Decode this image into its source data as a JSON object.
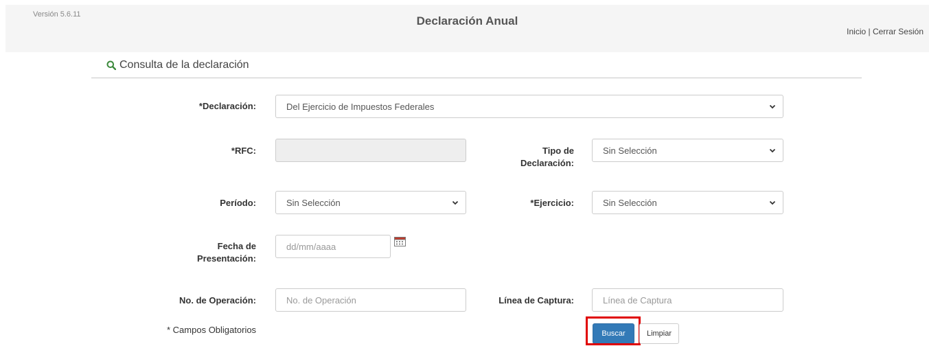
{
  "header": {
    "version": "Versión 5.6.11",
    "title": "Declaración Anual",
    "link_home": "Inicio",
    "separator": " | ",
    "link_logout": "Cerrar Sesión"
  },
  "section": {
    "title": "Consulta de la declaración",
    "icon": "search-icon"
  },
  "form": {
    "declaracion": {
      "label": "*Declaración:",
      "value": "Del Ejercicio de Impuestos Federales"
    },
    "rfc": {
      "label": "*RFC:",
      "value": ""
    },
    "tipo_declaracion": {
      "label_line1": "Tipo de",
      "label_line2": "Declaración:",
      "value": "Sin Selección"
    },
    "periodo": {
      "label": "Período:",
      "value": "Sin Selección"
    },
    "ejercicio": {
      "label": "*Ejercicio:",
      "value": "Sin Selección"
    },
    "fecha_presentacion": {
      "label_line1": "Fecha de",
      "label_line2": "Presentación:",
      "placeholder": "dd/mm/aaaa"
    },
    "no_operacion": {
      "label": "No. de Operación:",
      "placeholder": "No. de Operación"
    },
    "linea_captura": {
      "label": "Línea de Captura:",
      "placeholder": "Línea de Captura"
    },
    "required_note": "* Campos Obligatorios"
  },
  "buttons": {
    "search": "Buscar",
    "clear": "Limpiar"
  },
  "colors": {
    "accent_icon": "#3c8a3c",
    "primary_button": "#337ab7",
    "highlight": "#e00000"
  }
}
